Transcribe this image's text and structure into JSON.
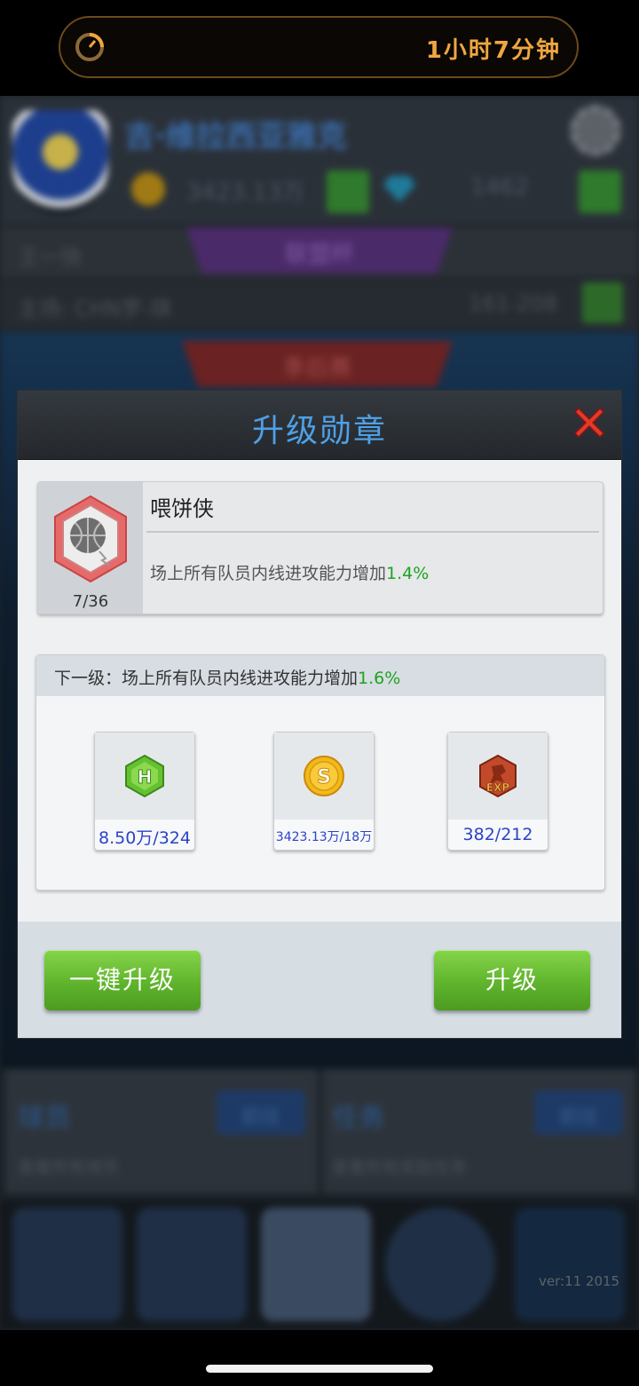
{
  "status": {
    "timer_text": "1小时7分钟"
  },
  "background": {
    "team_name": "吉·维拉西亚雅克",
    "coins": "3423.13万",
    "gems": "1462",
    "row2_left": "王一快",
    "row2_tab": "联盟杯",
    "row3_left": "主场: CHN罗-琪",
    "row3_right": "161-208",
    "row4_tab": "季后赛",
    "panel_left_title": "球员",
    "panel_left_btn": "前往",
    "panel_left_sub": "查看所有球员",
    "panel_right_title": "任务",
    "panel_right_btn": "前往",
    "panel_right_sub": "查看所有奖励任务",
    "version": "ver:11  2015"
  },
  "modal": {
    "title": "升级勋章",
    "medal": {
      "name": "喂饼侠",
      "count": "7/36",
      "desc_prefix": "场上所有队员内线进攻能力增加",
      "desc_value": "1.4%"
    },
    "next": {
      "label_prefix": "下一级：场上所有队员内线进攻能力增加",
      "label_value": "1.6%"
    },
    "costs": [
      {
        "icon": "h-hexagon-icon",
        "value": "8.50万/324"
      },
      {
        "icon": "gold-coin-icon",
        "value": "3423.13万/18万"
      },
      {
        "icon": "exp-icon",
        "value": "382/212"
      }
    ],
    "buttons": {
      "one_key": "一键升级",
      "upgrade": "升级"
    }
  },
  "colors": {
    "accent_blue": "#4ea0e6",
    "green_value": "#1ea31e",
    "cost_blue": "#2b43c8",
    "button_green": "#6cc23a",
    "timer_orange": "#f0a640"
  }
}
